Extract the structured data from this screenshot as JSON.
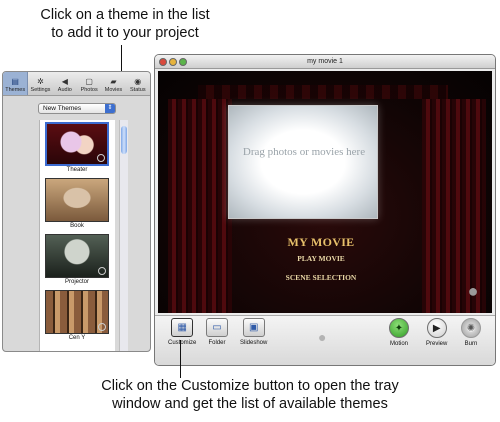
{
  "callouts": {
    "top_line1": "Click on a theme in the list",
    "top_line2": "to add it to your project",
    "bottom_line1": "Click on the Customize button to open the tray",
    "bottom_line2": "window and get the list of available themes"
  },
  "tray": {
    "tabs": [
      {
        "label": "Themes",
        "icon": "themes-icon"
      },
      {
        "label": "Settings",
        "icon": "gear-icon"
      },
      {
        "label": "Audio",
        "icon": "speaker-icon"
      },
      {
        "label": "Photos",
        "icon": "photos-icon"
      },
      {
        "label": "Movies",
        "icon": "film-icon"
      },
      {
        "label": "Status",
        "icon": "status-icon"
      }
    ],
    "theme_set": "New Themes",
    "themes": [
      {
        "label": "Theater"
      },
      {
        "label": "Book"
      },
      {
        "label": "Projector"
      },
      {
        "label": "Cen Y"
      }
    ]
  },
  "window": {
    "title": "my movie 1",
    "drop_zone_text": "Drag photos or movies here",
    "menu_title": "MY MOVIE",
    "menu_items": [
      "PLAY MOVIE",
      "SCENE SELECTION"
    ],
    "controls": {
      "customize": "Customize",
      "folder": "Folder",
      "slideshow": "Slideshow",
      "motion": "Motion",
      "preview": "Preview",
      "burn": "Burn"
    }
  },
  "colors": {
    "menu_title": "#e7c06a",
    "motion_active": "#2f9b23",
    "tray_tab_active": "#9bb2d4"
  }
}
